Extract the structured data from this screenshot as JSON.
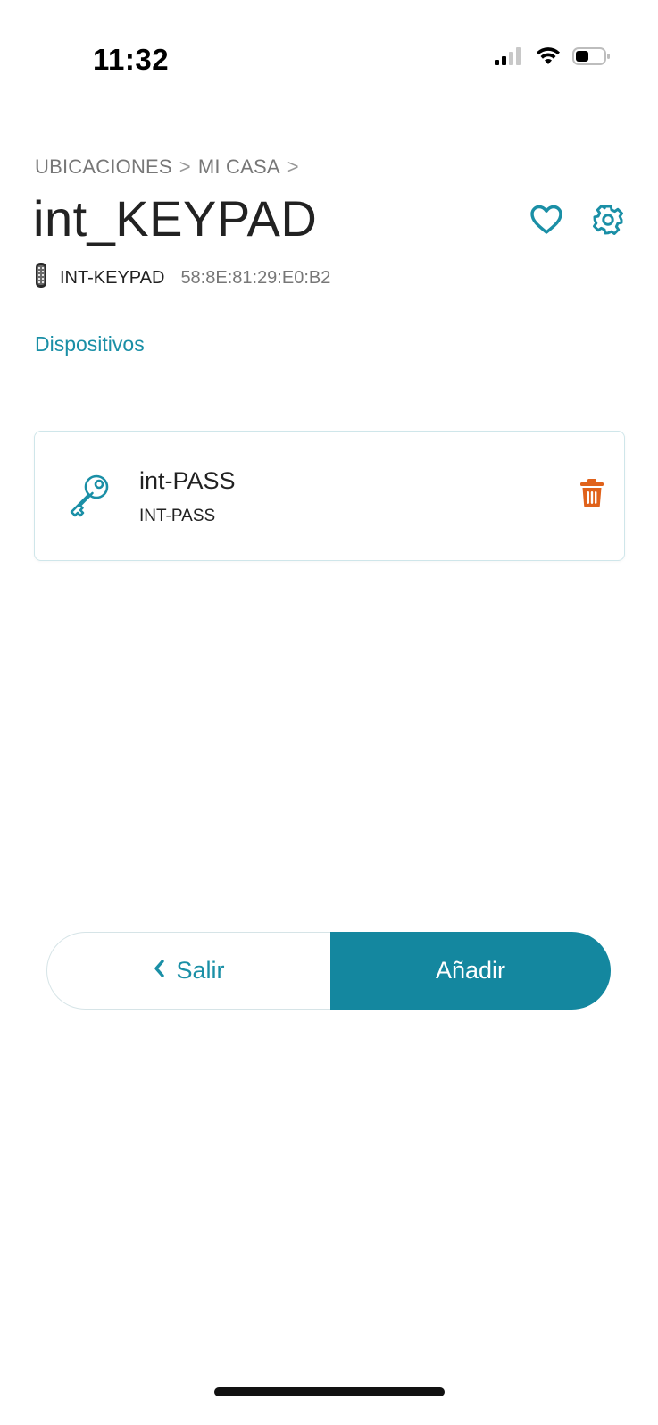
{
  "status_bar": {
    "time": "11:32"
  },
  "header": {
    "breadcrumb": [
      "UBICACIONES",
      "MI CASA"
    ],
    "breadcrumb_separator": ">",
    "title": "int_KEYPAD",
    "device_model": "INT-KEYPAD",
    "device_mac": "58:8E:81:29:E0:B2",
    "tab_label": "Dispositivos"
  },
  "devices": [
    {
      "name": "int-PASS",
      "type": "INT-PASS",
      "icon": "key-icon"
    }
  ],
  "footer": {
    "exit_label": "Salir",
    "add_label": "Añadir"
  },
  "colors": {
    "accent": "#1a8fa6",
    "primary_button": "#14879f",
    "delete": "#e0621b"
  }
}
